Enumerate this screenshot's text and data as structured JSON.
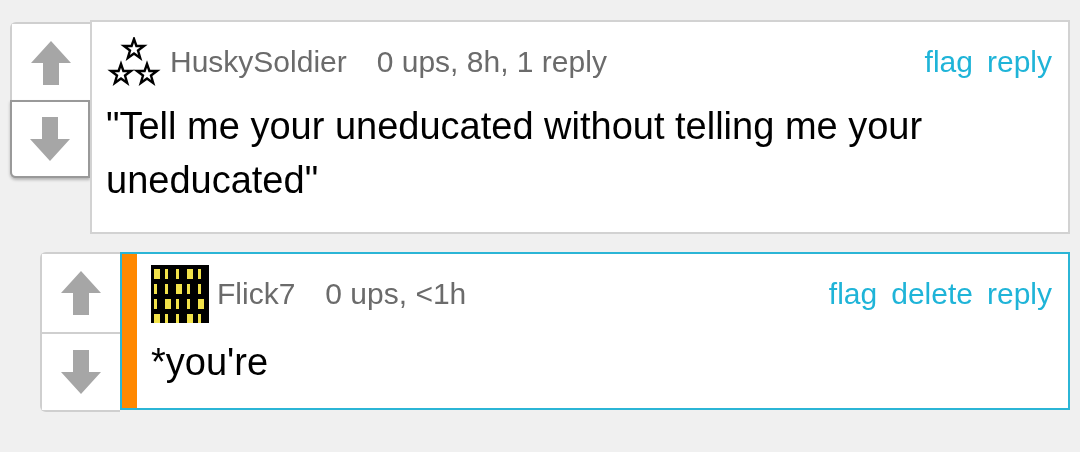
{
  "comments": [
    {
      "kind": "top",
      "avatar": {
        "kind": "stars"
      },
      "author": "HuskySoldier",
      "meta": "0 ups, 8h, 1 reply",
      "actions": [
        "flag",
        "reply"
      ],
      "body": "\"Tell me your uneducated without telling me your uneducated\"",
      "highlighted": false,
      "down_focused": true
    },
    {
      "kind": "reply",
      "author": "Flick7",
      "meta": "0 ups, <1h",
      "actions": [
        "flag",
        "delete",
        "reply"
      ],
      "body": "*you're",
      "highlighted": true,
      "down_focused": false
    }
  ]
}
